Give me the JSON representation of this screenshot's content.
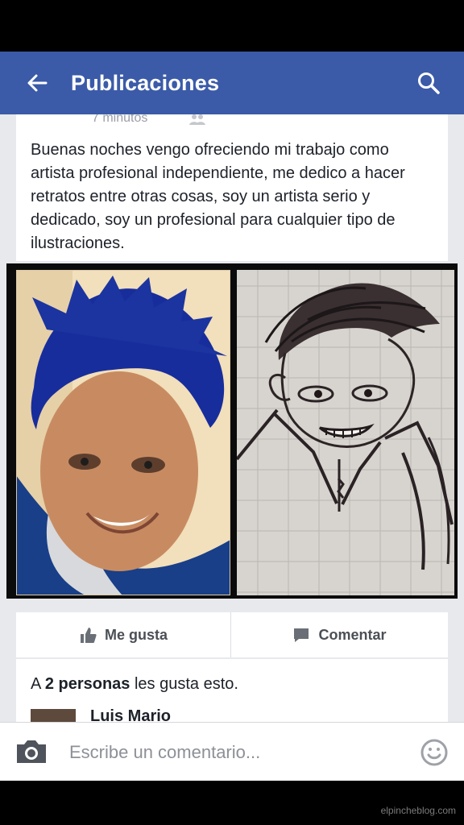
{
  "header": {
    "title": "Publicaciones",
    "back_icon": "arrow-left-icon",
    "search_icon": "search-icon",
    "background_color": "#3b5ba8"
  },
  "post": {
    "timestamp": "7 minutos",
    "text": "Buenas noches vengo ofreciendo mi trabajo como artista profesional independiente, me dedico a hacer retratos entre otras cosas, soy un artista serio y dedicado, soy un profesional para cualquier tipo de ilustraciones.",
    "actions": {
      "like": "Me gusta",
      "comment": "Comentar"
    },
    "likes": {
      "prefix": "A",
      "count": "2 personas",
      "suffix": "les gusta esto."
    },
    "first_commenter": "Luis Mario"
  },
  "composer": {
    "placeholder": "Escribe un comentario..."
  },
  "watermark": "elpincheblog.com"
}
